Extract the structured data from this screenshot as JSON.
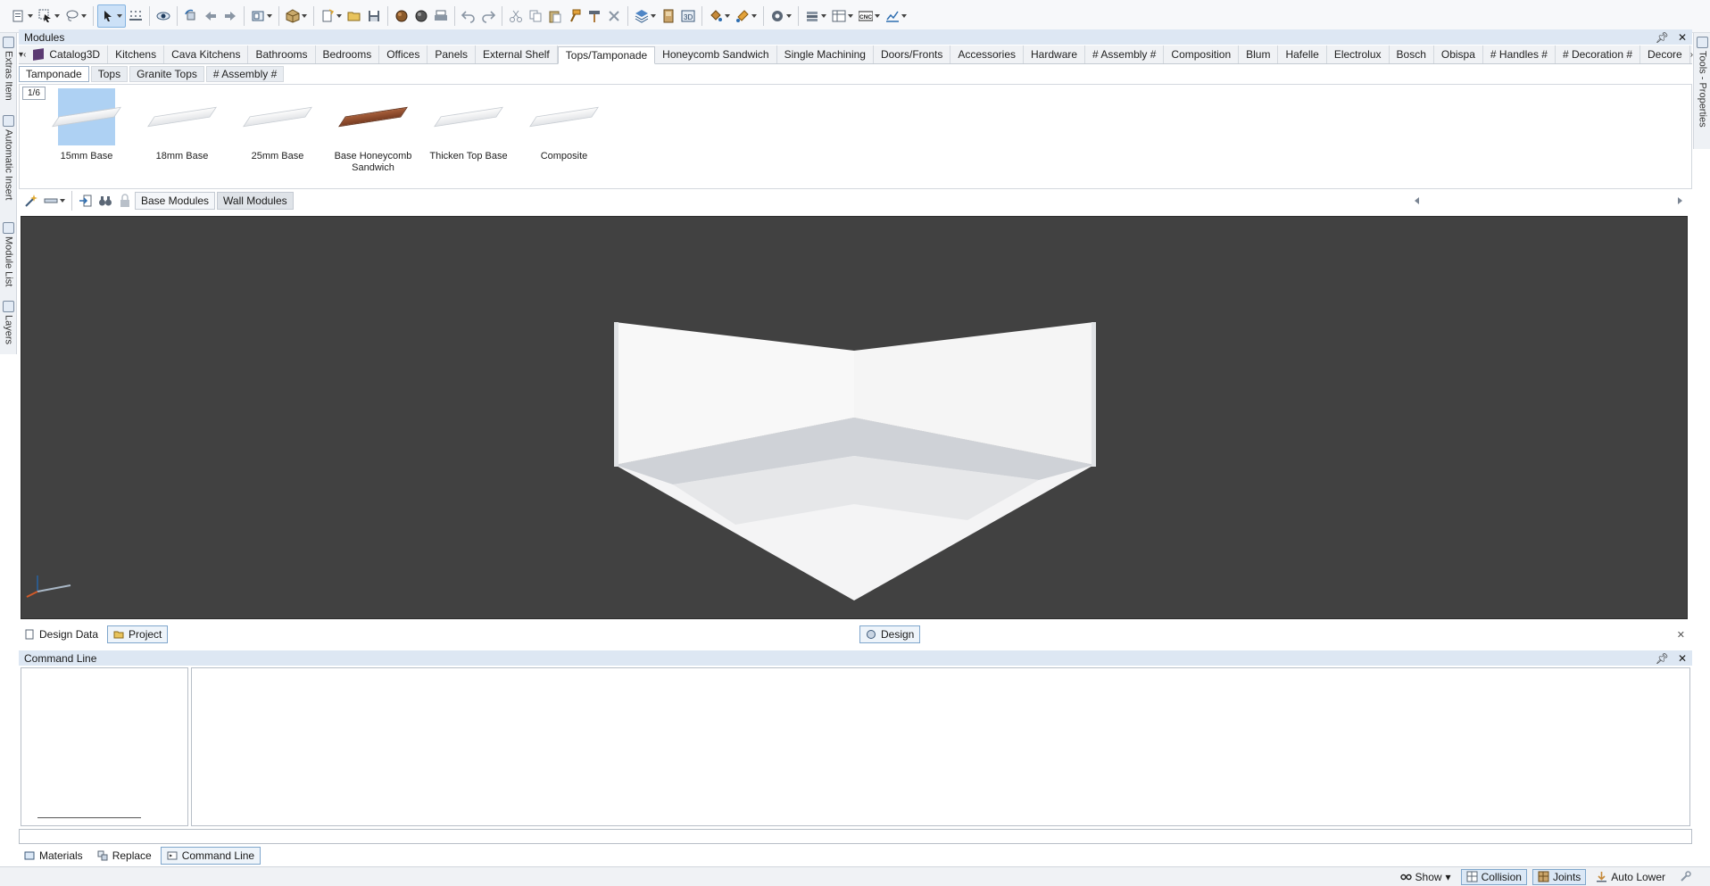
{
  "toolbar": {
    "icons": [
      "new-file-icon",
      "select-icon",
      "lasso-icon",
      "pointer-icon",
      "snap-grid-icon",
      "eye-icon",
      "rotate-left-icon",
      "arrow-left-icon",
      "arrow-right-icon",
      "view-cube-icon",
      "box-icon",
      "new-project-icon",
      "open-folder-icon",
      "save-icon",
      "render-icon",
      "render-alt-icon",
      "print-icon",
      "undo-icon",
      "redo-icon",
      "cut-icon",
      "copy-icon",
      "paste-icon",
      "format-painter-icon",
      "hammer-icon",
      "delete-icon",
      "layers-3d-icon",
      "door-icon",
      "text-3d-icon",
      "paint-bucket-icon",
      "paint-brush-icon",
      "settings-gear-icon",
      "stack-icon",
      "sheet-icon",
      "cnc-icon",
      "chart-icon"
    ]
  },
  "left_rail": {
    "tabs": [
      "Extras Item",
      "Automatic Insert",
      "Module List",
      "Layers"
    ]
  },
  "right_rail": {
    "tabs": [
      "Tools - Properties"
    ]
  },
  "modules": {
    "title": "Modules",
    "category_tabs": [
      "Catalog3D",
      "Kitchens",
      "Cava Kitchens",
      "Bathrooms",
      "Bedrooms",
      "Offices",
      "Panels",
      "External Shelf",
      "Tops/Tamponade",
      "Honeycomb Sandwich",
      "Single Machining",
      "Doors/Fronts",
      "Accessories",
      "Hardware",
      "# Assembly #",
      "Composition",
      "Blum",
      "Hafelle",
      "Electrolux",
      "Bosch",
      "Obispa",
      "# Handles #",
      "# Decoration #",
      "Decore"
    ],
    "selected_category": "Tops/Tamponade",
    "sub_tabs": [
      "Tamponade",
      "Tops",
      "Granite Tops",
      "# Assembly #"
    ],
    "selected_sub_tab": "Tamponade",
    "page_indicator": "1/6",
    "items": [
      {
        "label": "15mm Base",
        "selected": true
      },
      {
        "label": "18mm Base",
        "selected": false
      },
      {
        "label": "25mm Base",
        "selected": false
      },
      {
        "label": "Base Honeycomb Sandwich",
        "selected": false
      },
      {
        "label": "Thicken Top Base",
        "selected": false
      },
      {
        "label": "Composite",
        "selected": false
      }
    ]
  },
  "view_toolbar": {
    "buttons": [
      "Base Modules",
      "Wall Modules"
    ],
    "selected": "Wall Modules"
  },
  "viewport": {
    "background": "#414141",
    "wall_color": "#f7f7f7",
    "floor_color": "#e9eaec"
  },
  "doc_tabs": {
    "left": [
      "Design Data",
      "Project"
    ],
    "selected_left": "Project",
    "center": "Design"
  },
  "command_line": {
    "title": "Command Line",
    "input_value": ""
  },
  "bottom_tabs": {
    "tabs": [
      "Materials",
      "Replace",
      "Command Line"
    ],
    "selected": "Command Line"
  },
  "status": {
    "show": "Show",
    "collision": "Collision",
    "joints": "Joints",
    "auto_lower": "Auto Lower"
  }
}
